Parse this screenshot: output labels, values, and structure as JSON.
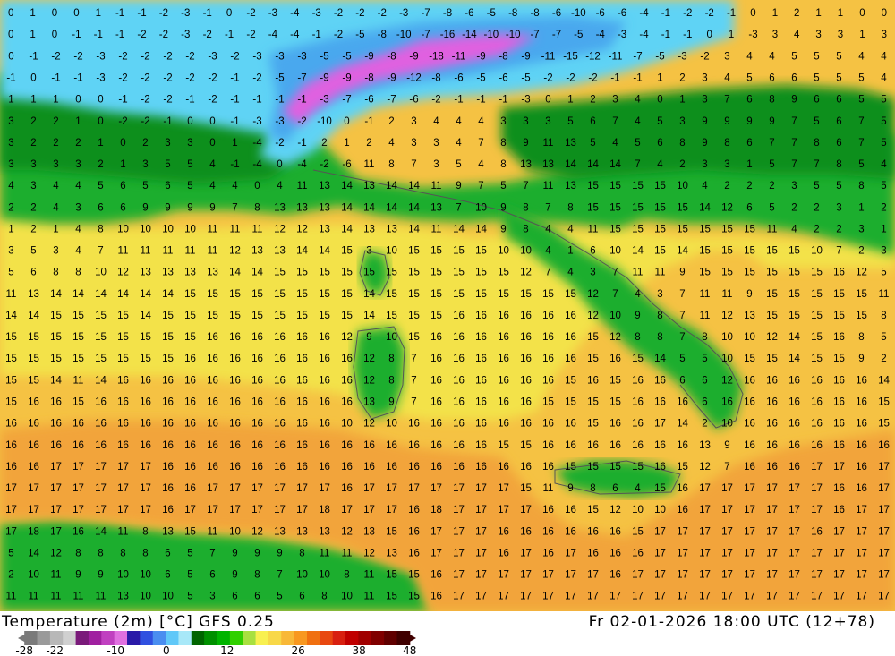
{
  "map": {
    "variable_label": "Temperature (2m) [°C] GFS 0.25",
    "valid_time": "Fr 02-01-2026 18:00 UTC (12+78)"
  },
  "legend": {
    "tick_labels": [
      "-28",
      "-22",
      "-10",
      "0",
      "12",
      "26",
      "38",
      "48"
    ],
    "tick_values": [
      -28,
      -22,
      -10,
      0,
      12,
      26,
      38,
      48
    ],
    "min": -28,
    "max": 48,
    "colors": [
      "#7a7a7a",
      "#9a9a9a",
      "#b8b8b8",
      "#d0d0d0",
      "#7a1a7a",
      "#a020a0",
      "#c040c0",
      "#e070e0",
      "#2a1aa8",
      "#3050e0",
      "#4a8ef0",
      "#60c8f8",
      "#a8e8f8",
      "#006400",
      "#009000",
      "#00b400",
      "#30d000",
      "#a8e040",
      "#f8f050",
      "#f8d848",
      "#f8b838",
      "#f89820",
      "#f07010",
      "#e84810",
      "#d82010",
      "#c00000",
      "#a00000",
      "#800000",
      "#600000",
      "#400000"
    ]
  },
  "map_colors": {
    "sea_warm": "#f5c243",
    "sea_mild": "#f3e24a",
    "land_green": "#1fae2f",
    "land_dark_green": "#0b8f1f",
    "cold_cyan": "#5fd3f5",
    "cold_blue": "#4aa8ee",
    "magenta": "#e060e0",
    "orange": "#f2a43a"
  },
  "grid_numbers": [
    [
      0,
      1,
      0,
      0,
      1,
      -1,
      -1,
      -2,
      -3,
      -1,
      0,
      -2,
      -3,
      -4,
      -3,
      -2,
      -2,
      -2,
      -3,
      -7,
      -8,
      -6,
      -5,
      -8,
      -8,
      -6,
      -10,
      -6,
      -6,
      -4,
      -1,
      -2,
      -2,
      -1,
      0,
      1,
      2,
      1,
      1,
      0,
      0
    ],
    [
      0,
      1,
      0,
      -1,
      -1,
      -1,
      -2,
      -2,
      -3,
      -2,
      -1,
      -2,
      -4,
      -4,
      -1,
      -2,
      -5,
      -8,
      -10,
      -7,
      -16,
      -14,
      -10,
      -10,
      -7,
      -7,
      -5,
      -4,
      -3,
      -4,
      -1,
      -1,
      0,
      1,
      -3,
      3,
      4,
      3,
      3,
      1,
      3
    ],
    [
      0,
      -1,
      -2,
      -2,
      -3,
      -2,
      -2,
      -2,
      -2,
      -3,
      -2,
      -3,
      -3,
      -3,
      -5,
      -5,
      -9,
      -8,
      -9,
      -18,
      -11,
      -9,
      -8,
      -9,
      -11,
      -15,
      -12,
      -11,
      -7,
      -5,
      -3,
      -2,
      3,
      4,
      4,
      5,
      5,
      5,
      4,
      4
    ],
    [
      -1,
      0,
      -1,
      -1,
      -3,
      -2,
      -2,
      -2,
      -2,
      -2,
      -1,
      -2,
      -5,
      -7,
      -9,
      -9,
      -8,
      -9,
      -12,
      -8,
      -6,
      -5,
      -6,
      -5,
      -2,
      -2,
      -2,
      -1,
      -1,
      1,
      2,
      3,
      4,
      5,
      6,
      6,
      5,
      5,
      5,
      4
    ],
    [
      1,
      1,
      1,
      0,
      0,
      -1,
      -2,
      -2,
      -1,
      -2,
      -1,
      -1,
      -1,
      -1,
      -3,
      -7,
      -6,
      -7,
      -6,
      -2,
      -1,
      -1,
      -1,
      -3,
      0,
      1,
      2,
      3,
      4,
      0,
      1,
      3,
      7,
      6,
      8,
      9,
      6,
      6,
      5,
      5
    ],
    [
      3,
      2,
      2,
      1,
      0,
      -2,
      -2,
      -1,
      0,
      0,
      -1,
      -3,
      -3,
      -2,
      -10,
      0,
      -1,
      2,
      3,
      4,
      4,
      4,
      3,
      3,
      3,
      5,
      6,
      7,
      4,
      5,
      3,
      9,
      9,
      9,
      9,
      7,
      5,
      6,
      7,
      5
    ],
    [
      3,
      2,
      2,
      2,
      1,
      0,
      2,
      3,
      3,
      0,
      1,
      -4,
      -2,
      -1,
      2,
      1,
      2,
      4,
      3,
      3,
      4,
      7,
      8,
      9,
      11,
      13,
      5,
      4,
      5,
      6,
      8,
      9,
      8,
      6,
      7,
      7,
      8,
      6,
      7,
      5
    ],
    [
      3,
      3,
      3,
      3,
      2,
      1,
      3,
      5,
      5,
      4,
      -1,
      -4,
      0,
      -4,
      -2,
      -6,
      11,
      8,
      7,
      3,
      5,
      4,
      8,
      13,
      13,
      14,
      14,
      14,
      7,
      4,
      2,
      3,
      3,
      1,
      5,
      7,
      7,
      8,
      5,
      4
    ],
    [
      4,
      3,
      4,
      4,
      5,
      6,
      5,
      6,
      5,
      4,
      4,
      0,
      4,
      11,
      13,
      14,
      13,
      14,
      14,
      11,
      9,
      7,
      5,
      7,
      11,
      13,
      15,
      15,
      15,
      15,
      10,
      4,
      2,
      2,
      2,
      3,
      5,
      5,
      8,
      5
    ],
    [
      2,
      2,
      4,
      3,
      6,
      6,
      9,
      9,
      9,
      9,
      7,
      8,
      13,
      13,
      13,
      14,
      14,
      14,
      14,
      13,
      7,
      10,
      9,
      8,
      7,
      8,
      15,
      15,
      15,
      15,
      15,
      14,
      12,
      6,
      5,
      2,
      2,
      3,
      1,
      2
    ],
    [
      1,
      2,
      1,
      4,
      8,
      10,
      10,
      10,
      10,
      11,
      11,
      11,
      12,
      12,
      13,
      14,
      13,
      13,
      14,
      11,
      14,
      14,
      9,
      8,
      4,
      4,
      11,
      15,
      15,
      15,
      15,
      15,
      15,
      15,
      11,
      4,
      2,
      2,
      3,
      1
    ],
    [
      3,
      5,
      3,
      4,
      7,
      11,
      11,
      11,
      11,
      11,
      12,
      13,
      13,
      14,
      14,
      15,
      3,
      10,
      15,
      15,
      15,
      15,
      10,
      10,
      4,
      1,
      6,
      10,
      14,
      15,
      14,
      15,
      15,
      15,
      15,
      15,
      10,
      7,
      2,
      3
    ],
    [
      5,
      6,
      8,
      8,
      10,
      12,
      13,
      13,
      13,
      13,
      14,
      14,
      15,
      15,
      15,
      15,
      15,
      15,
      15,
      15,
      15,
      15,
      15,
      12,
      7,
      4,
      3,
      7,
      11,
      11,
      9,
      15,
      15,
      15,
      15,
      15,
      15,
      16,
      12,
      5
    ],
    [
      11,
      13,
      14,
      14,
      14,
      14,
      14,
      14,
      15,
      15,
      15,
      15,
      15,
      15,
      15,
      15,
      14,
      15,
      15,
      15,
      15,
      15,
      15,
      15,
      15,
      15,
      12,
      7,
      4,
      3,
      7,
      11,
      11,
      9,
      15,
      15,
      15,
      15,
      15,
      11
    ],
    [
      14,
      14,
      15,
      15,
      15,
      15,
      14,
      15,
      15,
      15,
      15,
      15,
      15,
      15,
      15,
      15,
      14,
      15,
      15,
      15,
      16,
      16,
      16,
      16,
      16,
      16,
      12,
      10,
      9,
      8,
      7,
      11,
      12,
      13,
      15,
      15,
      15,
      15,
      15,
      8
    ],
    [
      15,
      15,
      15,
      15,
      15,
      15,
      15,
      15,
      15,
      16,
      16,
      16,
      16,
      16,
      16,
      12,
      9,
      10,
      15,
      16,
      16,
      16,
      16,
      16,
      16,
      16,
      15,
      12,
      8,
      8,
      7,
      8,
      10,
      10,
      12,
      14,
      15,
      16,
      8,
      5
    ],
    [
      15,
      15,
      15,
      15,
      15,
      15,
      15,
      15,
      16,
      16,
      16,
      16,
      16,
      16,
      16,
      16,
      12,
      8,
      7,
      16,
      16,
      16,
      16,
      16,
      16,
      16,
      15,
      16,
      15,
      14,
      5,
      5,
      10,
      15,
      15,
      14,
      15,
      15,
      9,
      2
    ],
    [
      15,
      15,
      14,
      11,
      14,
      16,
      16,
      16,
      16,
      16,
      16,
      16,
      16,
      16,
      16,
      16,
      12,
      8,
      7,
      16,
      16,
      16,
      16,
      16,
      16,
      15,
      16,
      15,
      16,
      16,
      6,
      6,
      12,
      16,
      16,
      16,
      16,
      16,
      16,
      14
    ],
    [
      15,
      16,
      16,
      15,
      16,
      16,
      16,
      16,
      16,
      16,
      16,
      16,
      16,
      16,
      16,
      16,
      13,
      9,
      7,
      16,
      16,
      16,
      16,
      16,
      15,
      15,
      15,
      15,
      16,
      16,
      16,
      6,
      16,
      16,
      16,
      16,
      16,
      16,
      16,
      15
    ],
    [
      16,
      16,
      16,
      16,
      16,
      16,
      16,
      16,
      16,
      16,
      16,
      16,
      16,
      16,
      16,
      10,
      12,
      10,
      16,
      16,
      16,
      16,
      16,
      16,
      16,
      16,
      15,
      16,
      16,
      17,
      14,
      2,
      10,
      16,
      16,
      16,
      16,
      16,
      16,
      15
    ],
    [
      16,
      16,
      16,
      16,
      16,
      16,
      16,
      16,
      16,
      16,
      16,
      16,
      16,
      16,
      16,
      16,
      16,
      16,
      16,
      16,
      16,
      16,
      15,
      15,
      16,
      16,
      16,
      16,
      16,
      16,
      16,
      13,
      9,
      16,
      16,
      16,
      16,
      16,
      16,
      16
    ],
    [
      16,
      16,
      17,
      17,
      17,
      17,
      17,
      16,
      16,
      16,
      16,
      16,
      16,
      16,
      16,
      16,
      16,
      16,
      16,
      16,
      16,
      16,
      16,
      16,
      16,
      15,
      15,
      15,
      15,
      16,
      15,
      12,
      7,
      16,
      16,
      16,
      17,
      17,
      16,
      17
    ],
    [
      17,
      17,
      17,
      17,
      17,
      17,
      17,
      16,
      16,
      17,
      17,
      17,
      17,
      17,
      17,
      16,
      17,
      17,
      17,
      17,
      17,
      17,
      17,
      15,
      11,
      9,
      8,
      6,
      4,
      15,
      16,
      17,
      17,
      17,
      17,
      17,
      17,
      16,
      16,
      17
    ],
    [
      17,
      17,
      17,
      17,
      17,
      17,
      17,
      16,
      17,
      17,
      17,
      17,
      17,
      17,
      18,
      17,
      17,
      17,
      16,
      18,
      17,
      17,
      17,
      17,
      16,
      16,
      15,
      12,
      10,
      10,
      16,
      17,
      17,
      17,
      17,
      17,
      17,
      16,
      17,
      17
    ],
    [
      17,
      18,
      17,
      16,
      14,
      11,
      8,
      13,
      15,
      11,
      10,
      12,
      13,
      13,
      13,
      12,
      13,
      15,
      16,
      17,
      17,
      17,
      16,
      16,
      16,
      16,
      16,
      16,
      15,
      17,
      17,
      17,
      17,
      17,
      17,
      17,
      16,
      17,
      17,
      17
    ],
    [
      5,
      14,
      12,
      8,
      8,
      8,
      8,
      6,
      5,
      7,
      9,
      9,
      9,
      8,
      11,
      11,
      12,
      13,
      16,
      17,
      17,
      17,
      16,
      17,
      16,
      17,
      16,
      16,
      16,
      17,
      17,
      17,
      17,
      17,
      17,
      17,
      17,
      17,
      17,
      17
    ],
    [
      2,
      10,
      11,
      9,
      9,
      10,
      10,
      6,
      5,
      6,
      9,
      8,
      7,
      10,
      10,
      8,
      11,
      15,
      15,
      16,
      17,
      17,
      17,
      17,
      17,
      17,
      17,
      16,
      17,
      17,
      17,
      17,
      17,
      17,
      17,
      17,
      17,
      17,
      17,
      17
    ],
    [
      11,
      11,
      11,
      11,
      11,
      13,
      10,
      10,
      5,
      3,
      6,
      6,
      5,
      6,
      8,
      10,
      11,
      15,
      15,
      16,
      17,
      17,
      17,
      17,
      17,
      17,
      17,
      17,
      17,
      17,
      17,
      17,
      17,
      17,
      17,
      17,
      17,
      17,
      17,
      17
    ]
  ]
}
